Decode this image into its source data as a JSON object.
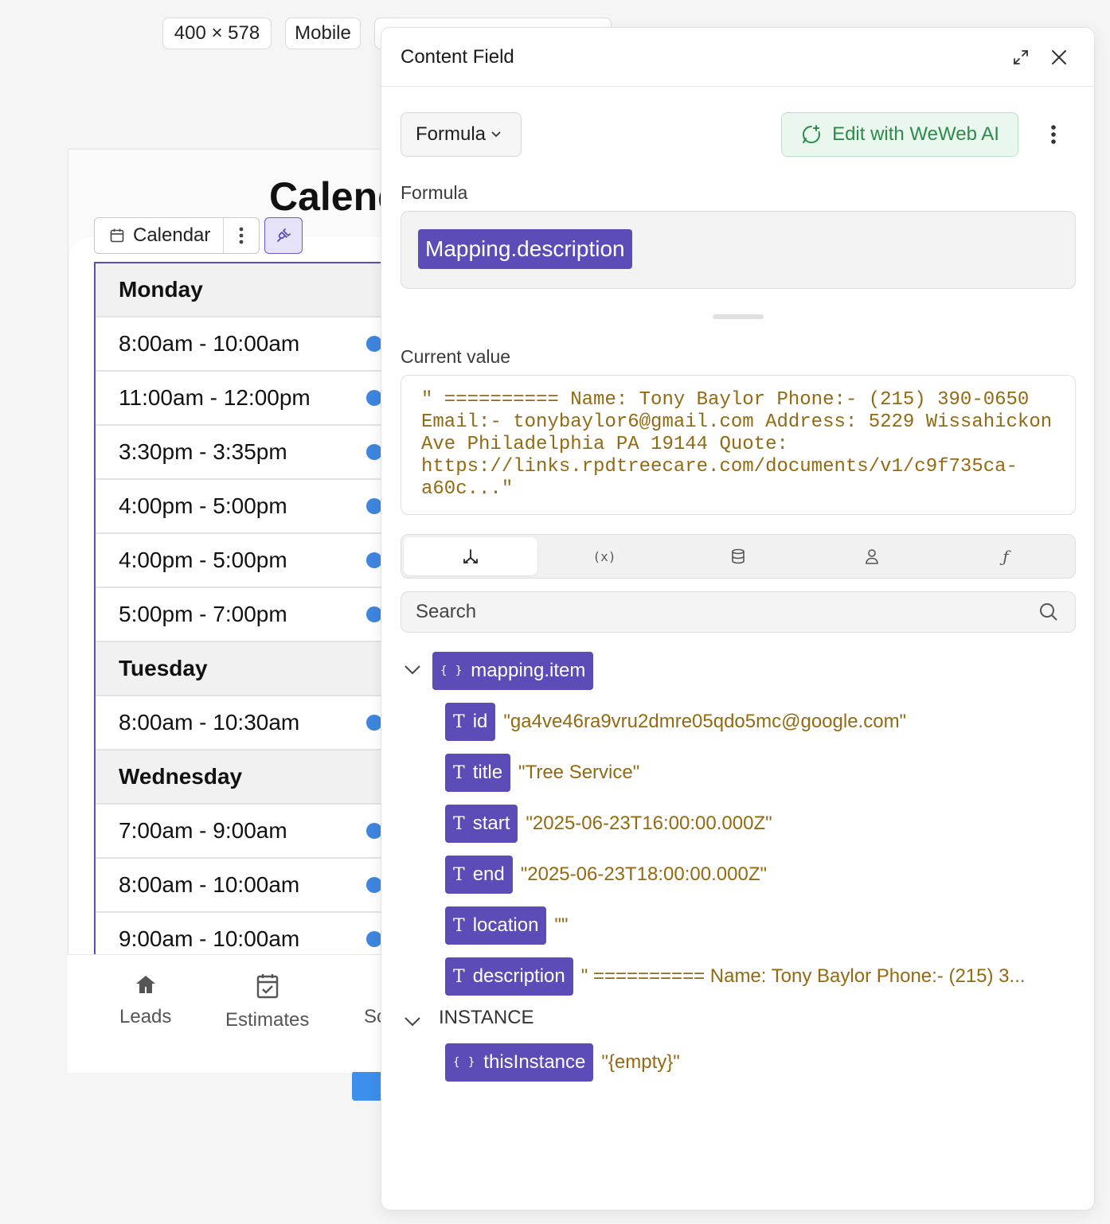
{
  "device": {
    "size": "400 × 578",
    "mode": "Mobile"
  },
  "preview": {
    "page_title": "Calendar",
    "toolbar": {
      "label": "Calendar"
    },
    "rows": [
      {
        "type": "day",
        "text": "Monday"
      },
      {
        "type": "slot",
        "text": "8:00am - 10:00am"
      },
      {
        "type": "slot",
        "text": "11:00am - 12:00pm"
      },
      {
        "type": "slot",
        "text": "3:30pm - 3:35pm"
      },
      {
        "type": "slot",
        "text": "4:00pm - 5:00pm"
      },
      {
        "type": "slot",
        "text": "4:00pm - 5:00pm"
      },
      {
        "type": "slot",
        "text": "5:00pm - 7:00pm"
      },
      {
        "type": "day",
        "text": "Tuesday"
      },
      {
        "type": "slot",
        "text": "8:00am - 10:30am"
      },
      {
        "type": "day",
        "text": "Wednesday"
      },
      {
        "type": "slot",
        "text": "7:00am - 9:00am"
      },
      {
        "type": "slot",
        "text": "8:00am - 10:00am"
      },
      {
        "type": "slot",
        "text": "9:00am - 10:00am"
      }
    ],
    "nav": [
      {
        "label": "Leads",
        "icon": "home-icon"
      },
      {
        "label": "Estimates",
        "icon": "calendar-check-icon"
      },
      {
        "label": "Sc",
        "icon": ""
      }
    ],
    "colors": {
      "accent": "#5b4cb8",
      "dot": "#3e86e0"
    }
  },
  "panel": {
    "title": "Content Field",
    "mode_select": "Formula",
    "ai_button": "Edit with WeWeb AI",
    "formula_label": "Formula",
    "formula_token": "Mapping.description",
    "current_value_label": "Current value",
    "current_value": "\" ========== Name: Tony Baylor Phone:- (215) 390-0650 Email:- tonybaylor6@gmail.com Address: 5229 Wissahickon Ave Philadelphia PA 19144 Quote: https://links.rpdtreecare.com/documents/v1/c9f735ca-a60c...\"",
    "tabs": [
      {
        "name": "tree-icon",
        "glyph": "⅄"
      },
      {
        "name": "variable-icon",
        "glyph": "(x)"
      },
      {
        "name": "database-icon",
        "glyph": ""
      },
      {
        "name": "user-icon",
        "glyph": ""
      },
      {
        "name": "function-icon",
        "glyph": "ƒ"
      }
    ],
    "search_placeholder": "Search",
    "tree": {
      "root_label": "mapping.item",
      "fields": [
        {
          "key": "id",
          "value": "\"ga4ve46ra9vru2dmre05qdo5mc@google.com\""
        },
        {
          "key": "title",
          "value": "\"Tree Service\""
        },
        {
          "key": "start",
          "value": "\"2025-06-23T16:00:00.000Z\""
        },
        {
          "key": "end",
          "value": "\"2025-06-23T18:00:00.000Z\""
        },
        {
          "key": "location",
          "value": "\"\""
        },
        {
          "key": "description",
          "value": "\" ========== Name: Tony Baylor Phone:- (215) 3..."
        }
      ],
      "instance_label": "INSTANCE",
      "instance_item": {
        "key": "thisInstance",
        "value": "\"{empty}\""
      }
    },
    "colors": {
      "pill": "#5b4cb8",
      "value_text": "#936a12",
      "ai_green": "#2e8a4a"
    }
  }
}
